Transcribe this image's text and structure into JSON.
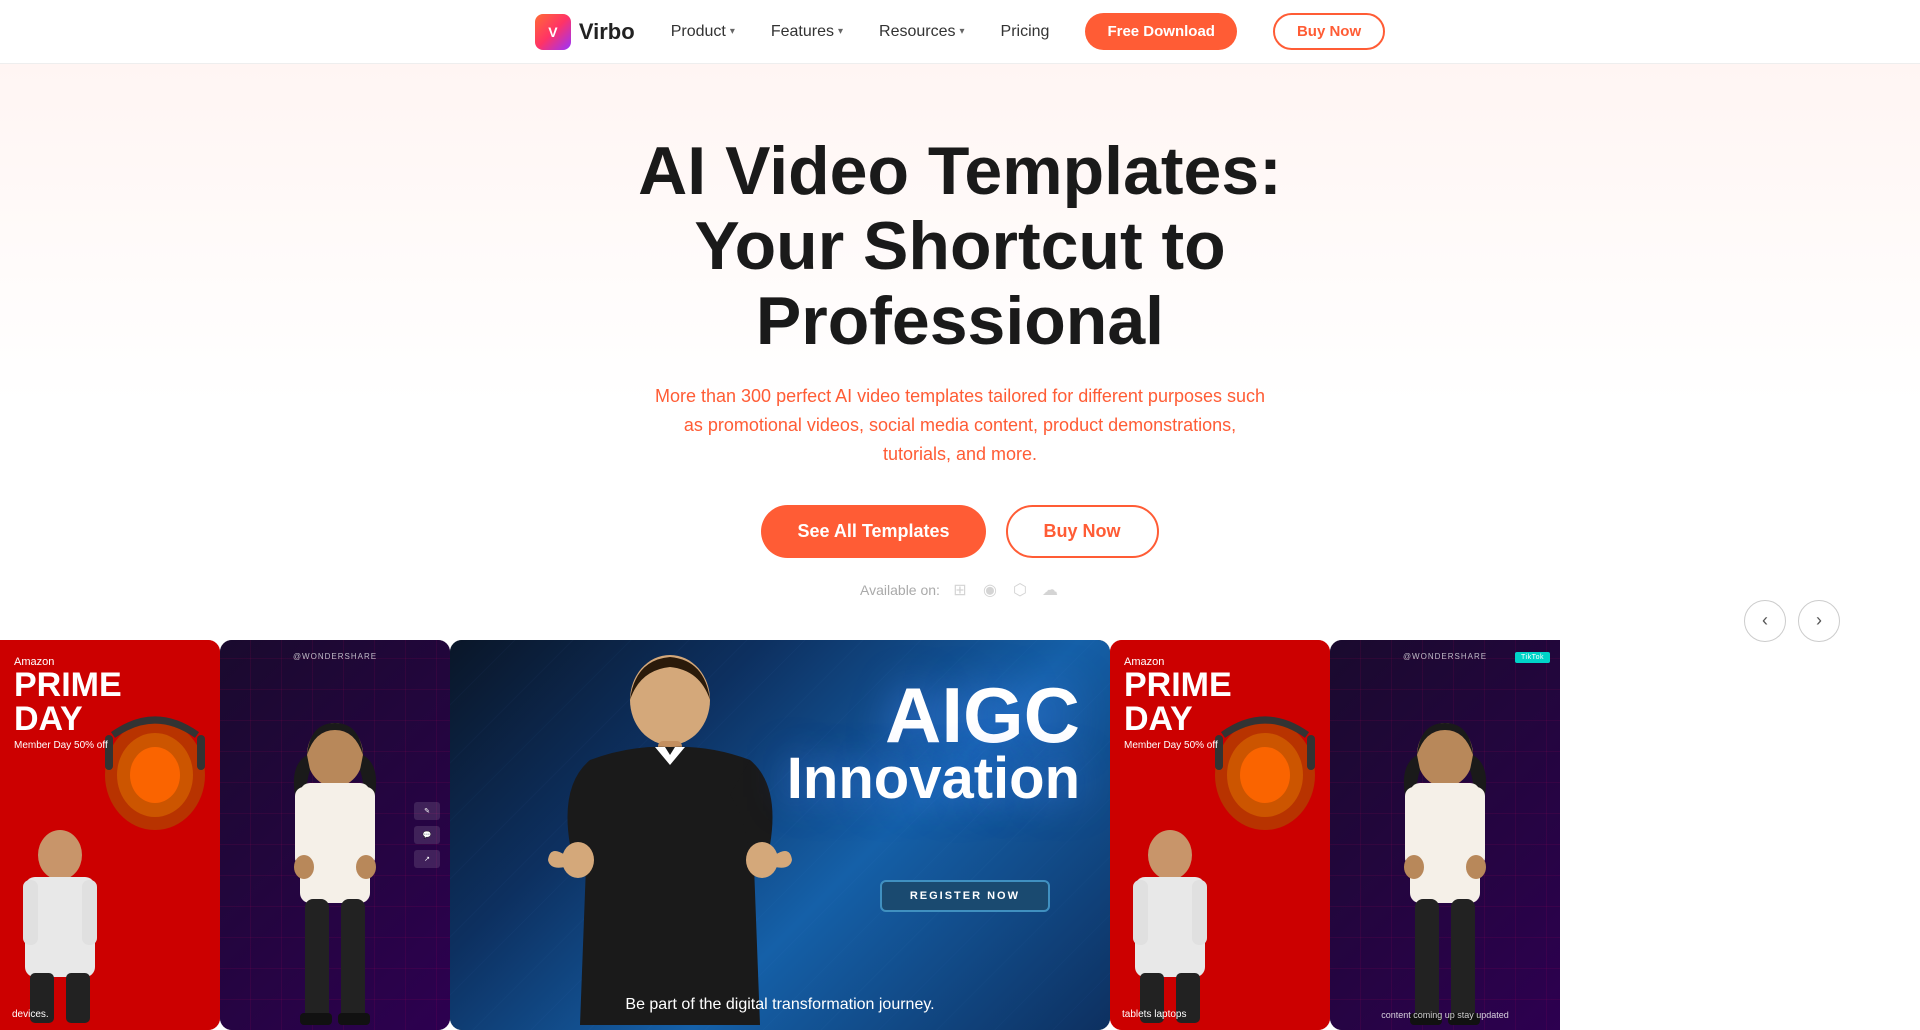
{
  "nav": {
    "logo_text": "Virbo",
    "items": [
      {
        "label": "Product",
        "has_dropdown": true
      },
      {
        "label": "Features",
        "has_dropdown": true
      },
      {
        "label": "Resources",
        "has_dropdown": true
      },
      {
        "label": "Pricing",
        "has_dropdown": false
      }
    ],
    "btn_free": "Free Download",
    "btn_buy": "Buy Now"
  },
  "hero": {
    "title_line1": "AI Video Templates:",
    "title_line2": "Your Shortcut to Professional",
    "description_prefix": "More than 300 perfect AI video templates tailored for different purposes such as ",
    "description_highlight": "promotional videos, social media content",
    "description_suffix": ", product demonstrations, tutorials, and more.",
    "btn_see_all": "See All Templates",
    "btn_buy": "Buy Now",
    "available_label": "Available on:"
  },
  "carousel": {
    "prev_label": "‹",
    "next_label": "›",
    "cards": [
      {
        "type": "amazon",
        "amazon_label": "Amazon",
        "prime_day": "PRIME DAY",
        "member_day": "Member Day 50% off",
        "bottom_text": "devices."
      },
      {
        "type": "dark_social",
        "watermark": "@WONDERSHARE"
      },
      {
        "type": "center_main",
        "aigc_line1": "AIGC",
        "aigc_line2": "Innovation",
        "register_btn": "REGISTER NOW",
        "bottom_text": "Be part of the digital transformation journey."
      },
      {
        "type": "amazon2",
        "amazon_label": "Amazon",
        "prime_day": "PRIME DAY",
        "member_day": "Member Day 50% off",
        "bottom_text": "tablets laptops"
      },
      {
        "type": "dark_social2",
        "watermark": "@WONDERSHARE",
        "bottom_text": "content coming up stay updated"
      }
    ]
  }
}
